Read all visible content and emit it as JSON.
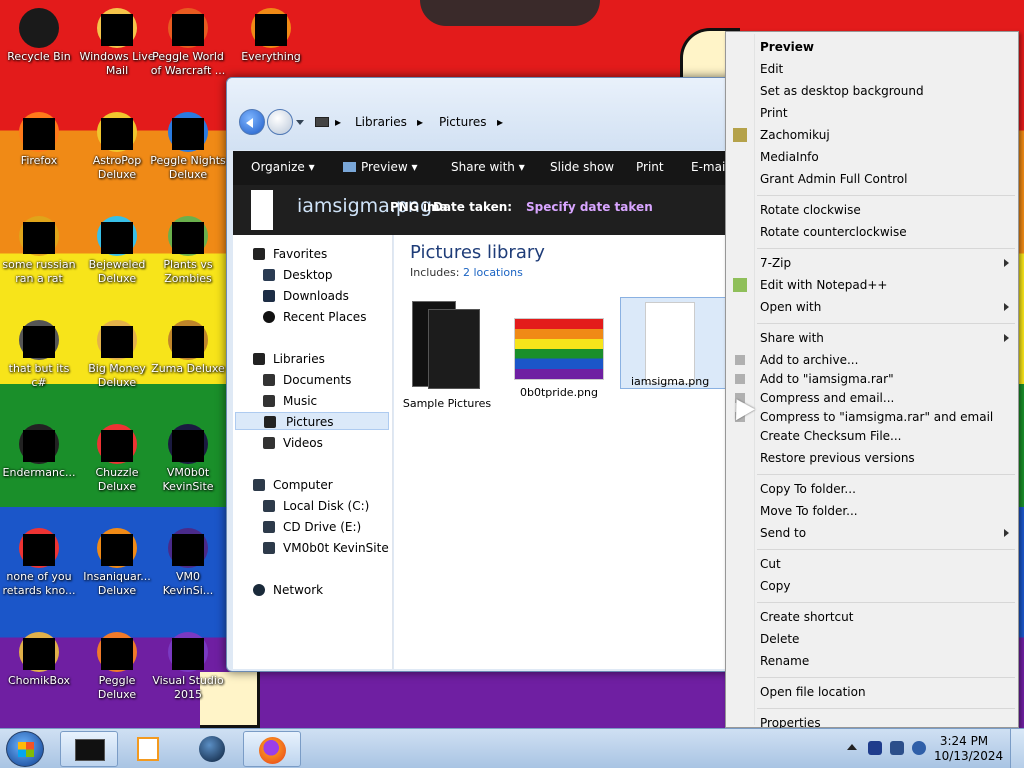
{
  "desktop": {
    "icons": [
      {
        "label": "Recycle Bin",
        "icon": "recycle-bin-icon"
      },
      {
        "label": "Windows Live Mail",
        "icon": "mail-icon"
      },
      {
        "label": "Peggle World of Warcraft ...",
        "icon": "peggle-icon"
      },
      {
        "label": "Everything",
        "icon": "search-icon"
      },
      {
        "label": "Firefox",
        "icon": "firefox-icon"
      },
      {
        "label": "AstroPop Deluxe",
        "icon": "astropop-icon"
      },
      {
        "label": "Peggle Nights Deluxe",
        "icon": "peggle-icon"
      },
      {
        "label": "some russian ran a rat",
        "icon": "file-icon"
      },
      {
        "label": "Bejeweled Deluxe",
        "icon": "gem-icon"
      },
      {
        "label": "Plants vs Zombies",
        "icon": "plant-icon"
      },
      {
        "label": "that but its c#",
        "icon": "file-icon"
      },
      {
        "label": "Big Money Deluxe",
        "icon": "money-icon"
      },
      {
        "label": "Zuma Deluxe",
        "icon": "zuma-icon"
      },
      {
        "label": "Endermanc...",
        "icon": "file-icon"
      },
      {
        "label": "Chuzzle Deluxe",
        "icon": "chuzzle-icon"
      },
      {
        "label": "VM0b0t KevinSite",
        "icon": "app-icon"
      },
      {
        "label": "none of you retards kno...",
        "icon": "file-icon"
      },
      {
        "label": "Insaniquar... Deluxe",
        "icon": "fish-icon"
      },
      {
        "label": "VM0 KevinSi...",
        "icon": "app-icon"
      },
      {
        "label": "ChomikBox",
        "icon": "chomikbox-icon"
      },
      {
        "label": "Peggle Deluxe",
        "icon": "peggle-icon"
      },
      {
        "label": "Visual Studio 2015",
        "icon": "visual-studio-icon"
      }
    ]
  },
  "explorer": {
    "breadcrumb": [
      "Libraries",
      "Pictures"
    ],
    "toolbar": [
      "Organize",
      "Preview",
      "Share with",
      "Slide show",
      "Print",
      "E-mail"
    ],
    "details": {
      "filename": "iamsigma.png",
      "filetype": "PNG ima",
      "date_label": "Date taken:",
      "date_value": "Specify date taken"
    },
    "nav": {
      "favorites": {
        "header": "Favorites",
        "items": [
          "Desktop",
          "Downloads",
          "Recent Places"
        ]
      },
      "libraries": {
        "header": "Libraries",
        "items": [
          "Documents",
          "Music",
          "Pictures",
          "Videos"
        ]
      },
      "computer": {
        "header": "Computer",
        "items": [
          "Local Disk (C:)",
          "CD Drive (E:)",
          "VM0b0t KevinSite"
        ]
      },
      "network": {
        "header": "Network"
      }
    },
    "content": {
      "title": "Pictures library",
      "includes_label": "Includes:",
      "includes_link": "2 locations",
      "items": [
        "Sample Pictures",
        "0b0tpride.png",
        "iamsigma.png"
      ]
    }
  },
  "context_menu": {
    "groups": [
      [
        {
          "label": "Preview",
          "bold": true
        },
        {
          "label": "Edit"
        },
        {
          "label": "Set as desktop background"
        },
        {
          "label": "Print"
        },
        {
          "label": "Zachomikuj",
          "icon": "chomikbox-icon"
        },
        {
          "label": "MediaInfo"
        },
        {
          "label": "Grant Admin Full Control"
        }
      ],
      [
        {
          "label": "Rotate clockwise"
        },
        {
          "label": "Rotate counterclockwise"
        }
      ],
      [
        {
          "label": "7-Zip",
          "submenu": true
        },
        {
          "label": "Edit with Notepad++",
          "icon": "notepad-icon"
        },
        {
          "label": "Open with",
          "submenu": true
        }
      ],
      [
        {
          "label": "Share with",
          "submenu": true
        },
        {
          "label": "Add to archive...",
          "icon": "archive-icon"
        },
        {
          "label": "Add to \"iamsigma.rar\"",
          "icon": "archive-icon"
        },
        {
          "label": "Compress and email...",
          "icon": "archive-icon"
        },
        {
          "label": "Compress to \"iamsigma.rar\" and email",
          "icon": "archive-icon"
        },
        {
          "label": "Create Checksum File..."
        },
        {
          "label": "Restore previous versions"
        }
      ],
      [
        {
          "label": "Copy To folder..."
        },
        {
          "label": "Move To folder..."
        },
        {
          "label": "Send to",
          "submenu": true
        }
      ],
      [
        {
          "label": "Cut"
        },
        {
          "label": "Copy"
        }
      ],
      [
        {
          "label": "Create shortcut"
        },
        {
          "label": "Delete"
        },
        {
          "label": "Rename"
        }
      ],
      [
        {
          "label": "Open file location"
        }
      ],
      [
        {
          "label": "Properties"
        }
      ]
    ]
  },
  "taskbar": {
    "clock": {
      "time": "3:24 PM",
      "date": "10/13/2024"
    }
  }
}
